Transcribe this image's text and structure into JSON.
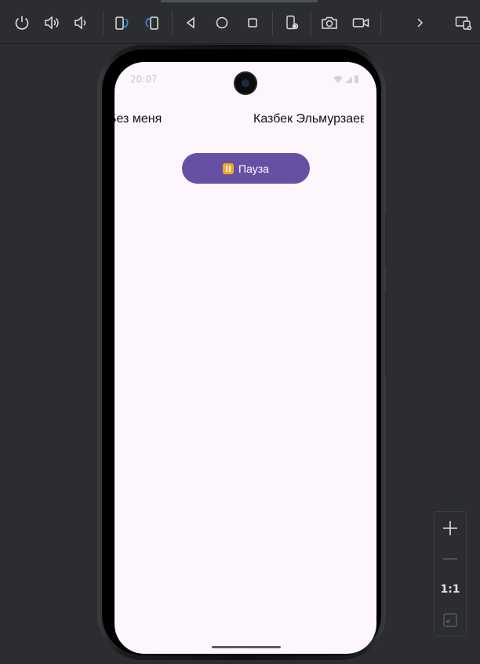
{
  "toolbar": {
    "items": [
      {
        "name": "power-icon"
      },
      {
        "name": "volume-up-icon"
      },
      {
        "name": "volume-down-icon"
      },
      {
        "name": "rotate-left-icon"
      },
      {
        "name": "rotate-right-icon"
      },
      {
        "name": "back-icon"
      },
      {
        "name": "home-icon"
      },
      {
        "name": "overview-icon"
      },
      {
        "name": "device-settings-icon"
      },
      {
        "name": "screenshot-camera-icon"
      },
      {
        "name": "screen-record-icon"
      },
      {
        "name": "chevron-right-icon"
      },
      {
        "name": "device-mirror-icon"
      }
    ]
  },
  "device_screen": {
    "status_time": "20:07",
    "now_playing": {
      "title": "Без меня",
      "artist": "Казбек Эльмурзаев"
    },
    "pause_button": {
      "emoji": "⏸",
      "label": "Пауза"
    },
    "accent_color": "#6750a4",
    "background_color": "#fdf6fd"
  },
  "zoom_controls": {
    "zoom_in": "+",
    "zoom_out": "−",
    "zoom_level": "1:1"
  }
}
